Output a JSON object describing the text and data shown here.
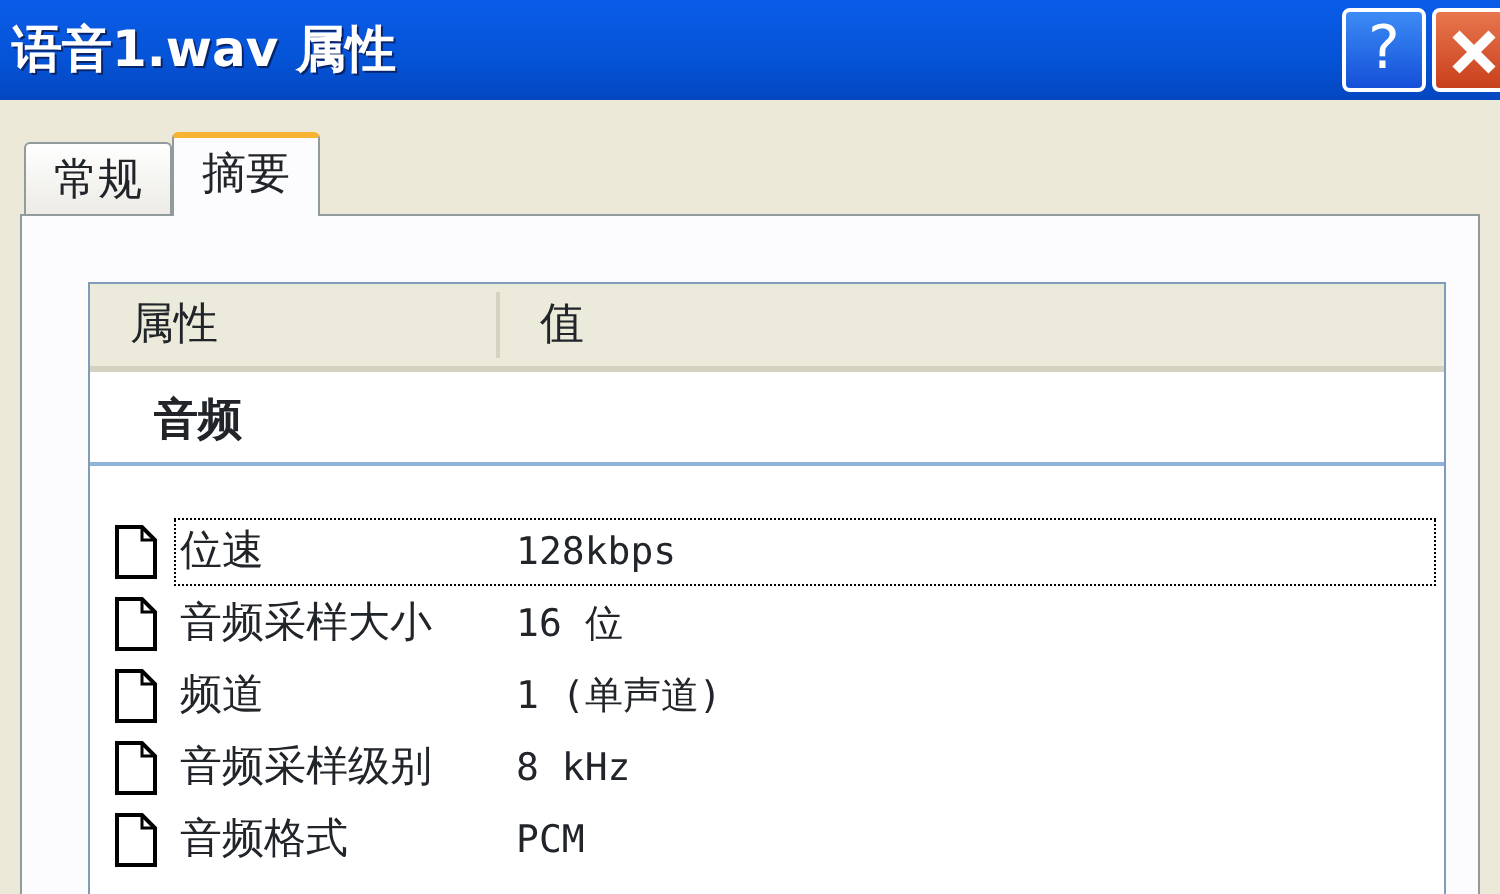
{
  "window": {
    "title": "语音1.wav 属性",
    "help_button": "?"
  },
  "tabs": [
    {
      "label": "常规",
      "selected": false
    },
    {
      "label": "摘要",
      "selected": true
    }
  ],
  "list": {
    "columns": [
      "属性",
      "值"
    ],
    "group": "音频",
    "rows": [
      {
        "name": "位速",
        "value": "128kbps",
        "selected": true
      },
      {
        "name": "音频采样大小",
        "value": "16 位",
        "selected": false
      },
      {
        "name": "频道",
        "value": "1 (单声道)",
        "selected": false
      },
      {
        "name": "音频采样级别",
        "value": "8 kHz",
        "selected": false
      },
      {
        "name": "音频格式",
        "value": "PCM",
        "selected": false
      }
    ]
  }
}
